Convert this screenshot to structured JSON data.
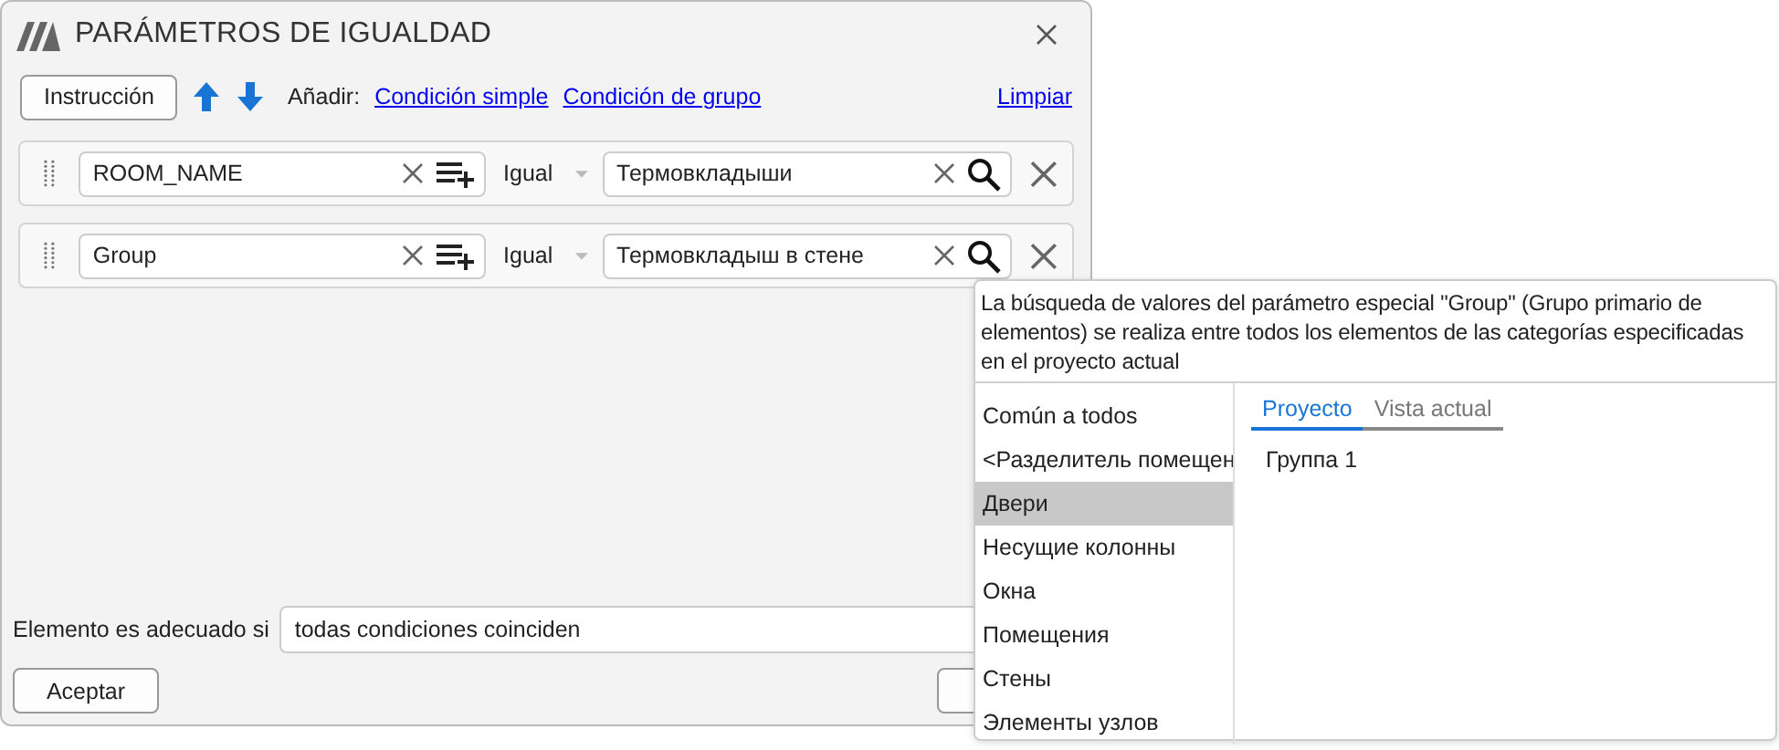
{
  "window": {
    "title": "PARÁMETROS DE IGUALDAD"
  },
  "toolbar": {
    "instruction_button": "Instrucción",
    "add_label": "Añadir:",
    "add_links": [
      "Condición simple",
      "Condición de grupo"
    ],
    "clear_link": "Limpiar"
  },
  "conditions": [
    {
      "parameter": "ROOM_NAME",
      "operator": "Igual",
      "value": "Термовкладыши"
    },
    {
      "parameter": "Group",
      "operator": "Igual",
      "value": "Термовкладыш в стене"
    }
  ],
  "match": {
    "label": "Elemento es adecuado si",
    "value": "todas condiciones coinciden"
  },
  "buttons": {
    "accept": "Aceptar"
  },
  "popup": {
    "description": "La búsqueda de valores del parámetro especial \"Group\" (Grupo primario de elementos) se realiza entre todos los elementos de las categorías especificadas en el proyecto actual",
    "categories": [
      {
        "label": "Común a todos",
        "selected": false
      },
      {
        "label": "<Разделитель помещен",
        "selected": false
      },
      {
        "label": "Двери",
        "selected": true
      },
      {
        "label": "Несущие колонны",
        "selected": false
      },
      {
        "label": "Окна",
        "selected": false
      },
      {
        "label": "Помещения",
        "selected": false
      },
      {
        "label": "Стены",
        "selected": false
      },
      {
        "label": "Элементы узлов",
        "selected": false
      }
    ],
    "tabs": [
      {
        "label": "Proyecto",
        "selected": true
      },
      {
        "label": "Vista actual",
        "selected": false
      }
    ],
    "values": [
      "Группа 1"
    ]
  }
}
